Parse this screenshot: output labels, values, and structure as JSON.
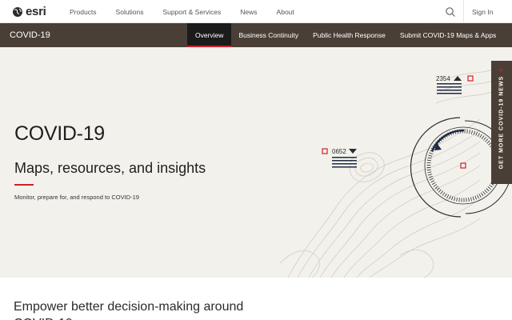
{
  "brand": {
    "logo_text": "esri",
    "accent": "#d0202a",
    "subnav_bg": "#4a3f37"
  },
  "topnav": {
    "links": [
      "Products",
      "Solutions",
      "Support & Services",
      "News",
      "About"
    ],
    "search_icon": "search-icon",
    "signin": "Sign In"
  },
  "subnav": {
    "title": "COVID-19",
    "tabs": [
      "Overview",
      "Business Continuity",
      "Public Health Response",
      "Submit COVID-19 Maps & Apps"
    ],
    "active_tab": "Overview"
  },
  "hero": {
    "title": "COVID-19",
    "subtitle": "Maps, resources, and insights",
    "description": "Monitor, prepare for, and respond to COVID-19",
    "markers": [
      "2354",
      "0652"
    ]
  },
  "side_tab": {
    "label": "GET MORE COVID-19 NEWS"
  },
  "lower": {
    "heading": "Empower better decision-making around COVID-19"
  }
}
